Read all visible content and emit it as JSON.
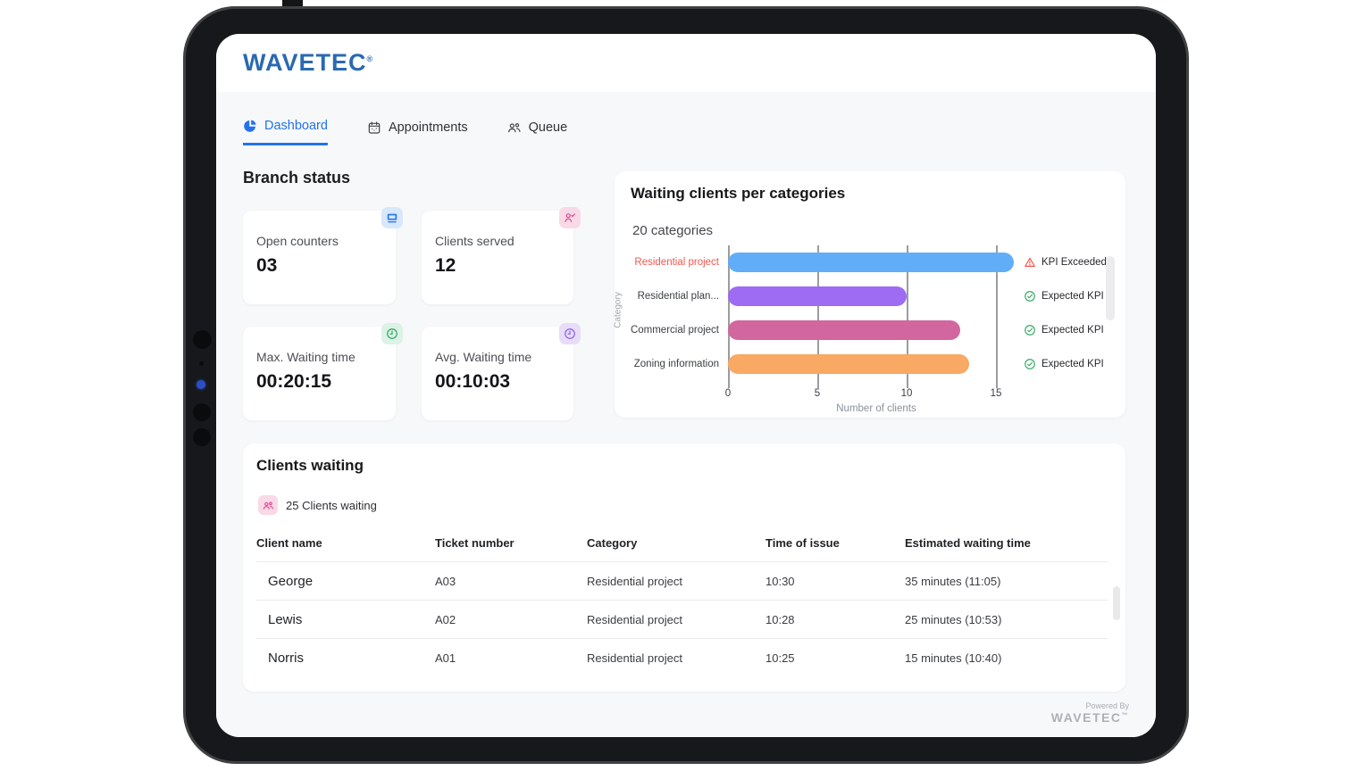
{
  "brand": {
    "name": "WAVETEC",
    "registered_mark": "®"
  },
  "nav": {
    "tabs": [
      {
        "label": "Dashboard",
        "icon": "pie-chart-icon",
        "active": true
      },
      {
        "label": "Appointments",
        "icon": "calendar-icon",
        "active": false
      },
      {
        "label": "Queue",
        "icon": "people-icon",
        "active": false
      }
    ]
  },
  "branch_status": {
    "title": "Branch status",
    "cards": [
      {
        "label": "Open counters",
        "value": "03",
        "icon": "counter-icon",
        "icon_color": "#2e7be9",
        "icon_bg": "#d8e8fb"
      },
      {
        "label": "Clients served",
        "value": "12",
        "icon": "person-check-icon",
        "icon_color": "#e0458c",
        "icon_bg": "#f9d9e7"
      },
      {
        "label": "Max. Waiting time",
        "value": "00:20:15",
        "icon": "clock-icon",
        "icon_color": "#2aa55f",
        "icon_bg": "#dcf2e6"
      },
      {
        "label": "Avg. Waiting time",
        "value": "00:10:03",
        "icon": "clock-icon",
        "icon_color": "#8a5be4",
        "icon_bg": "#e7ddf9"
      }
    ]
  },
  "chart_data": {
    "type": "bar",
    "orientation": "horizontal",
    "title": "Waiting clients per categories",
    "subtitle": "20 categories",
    "categories": [
      "Residential project",
      "Residential plan...",
      "Commercial project",
      "Zoning information"
    ],
    "values": [
      16,
      10,
      13,
      13.5
    ],
    "bar_colors": [
      "#61adf8",
      "#9e6bf3",
      "#d2679f",
      "#f8a963"
    ],
    "kpi": [
      {
        "label": "KPI Exceeded",
        "status": "exceeded"
      },
      {
        "label": "Expected KPI",
        "status": "expected"
      },
      {
        "label": "Expected KPI",
        "status": "expected"
      },
      {
        "label": "Expected KPI",
        "status": "expected"
      }
    ],
    "xlabel": "Number of clients",
    "ylabel": "Category",
    "xticks": [
      0,
      5,
      10,
      15
    ],
    "xlim": [
      0,
      16.6
    ],
    "grid": "vertical",
    "legend_position": "right",
    "exceeded_color": "#f4564e",
    "expected_color": "#34a862"
  },
  "clients_waiting": {
    "title": "Clients waiting",
    "count_label": "25 Clients waiting",
    "columns": [
      "Client name",
      "Ticket number",
      "Category",
      "Time of issue",
      "Estimated waiting time"
    ],
    "rows": [
      {
        "name": "George",
        "ticket": "A03",
        "category": "Residential project",
        "time": "10:30",
        "estimated": "35 minutes (11:05)"
      },
      {
        "name": "Lewis",
        "ticket": "A02",
        "category": "Residential project",
        "time": "10:28",
        "estimated": "25 minutes (10:53)"
      },
      {
        "name": "Norris",
        "ticket": "A01",
        "category": "Residential project",
        "time": "10:25",
        "estimated": "15 minutes (10:40)"
      }
    ]
  },
  "footer": {
    "powered_by": "Powered By",
    "brand": "WAVETEC",
    "trademark": "™"
  }
}
